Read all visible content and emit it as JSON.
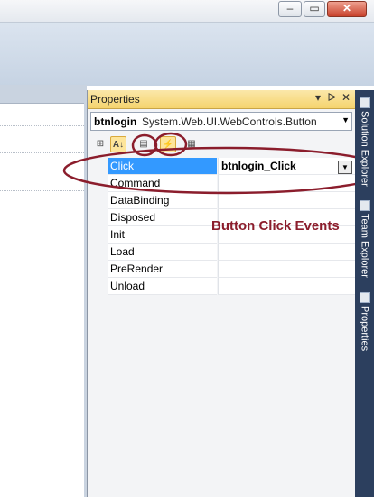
{
  "window": {
    "minimize_icon": "minimize-icon",
    "maximize_icon": "maximize-icon",
    "close_icon": "close-icon"
  },
  "properties_panel": {
    "title": "Properties",
    "title_buttons": [
      "▾",
      "ᐅ",
      "✕"
    ],
    "object_name": "btnlogin",
    "object_type": "System.Web.UI.WebControls.Button",
    "toolbar": [
      "categorized-icon",
      "alphabetical-icon",
      "properties-icon",
      "events-icon",
      "property-pages-icon"
    ],
    "events": [
      {
        "name": "Click",
        "value": "btnlogin_Click",
        "selected": true
      },
      {
        "name": "Command",
        "value": ""
      },
      {
        "name": "DataBinding",
        "value": ""
      },
      {
        "name": "Disposed",
        "value": ""
      },
      {
        "name": "Init",
        "value": ""
      },
      {
        "name": "Load",
        "value": ""
      },
      {
        "name": "PreRender",
        "value": ""
      },
      {
        "name": "Unload",
        "value": ""
      }
    ]
  },
  "annotation": {
    "text": "Button Click Events",
    "color": "#8b1d2c"
  },
  "right_tabs": [
    {
      "label": "Solution Explorer"
    },
    {
      "label": "Team Explorer"
    },
    {
      "label": "Properties"
    }
  ]
}
